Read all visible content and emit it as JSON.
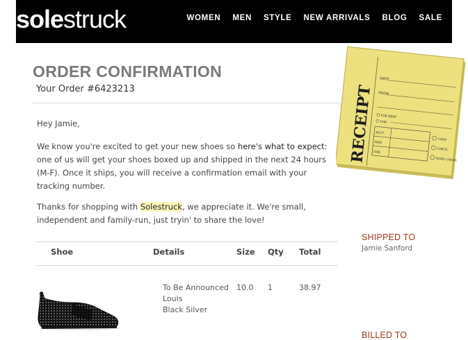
{
  "header": {
    "logo_bold": "sole",
    "logo_light": "struck",
    "nav": [
      "WOMEN",
      "MEN",
      "STYLE",
      "NEW ARRIVALS",
      "BLOG",
      "SALE"
    ]
  },
  "order": {
    "title": "ORDER CONFIRMATION",
    "number_line": "Your Order #6423213"
  },
  "message": {
    "greeting": "Hey Jamie,",
    "p1_before": "We know you're excited to get your new shoes so ",
    "p1_emphasis": "here's what to expect:",
    "p1_after": " one of us will get your shoes boxed up and shipped in the next 24 hours (M-F). Once it ships, you will receive a confirmation email with your tracking number.",
    "p2_before": "Thanks for shopping with ",
    "p2_highlight": "Solestruck",
    "p2_after": ", we appreciate it. We're small, independent and family-run, just tryin' to share the love!"
  },
  "table": {
    "headers": {
      "shoe": "Shoe",
      "details": "Details",
      "size": "Size",
      "qty": "Qty",
      "total": "Total"
    },
    "row": {
      "details": [
        "To Be Announced",
        "Louis",
        "Black Silver"
      ],
      "size": "10.0",
      "qty": "1",
      "total": "38.97"
    }
  },
  "receipt_image": {
    "heading": "RECEIPT",
    "fields": [
      "DATE",
      "FROM",
      "FOR RENT",
      "FOR",
      "ACCT.",
      "PAID",
      "DUE",
      "CASH",
      "CHECK",
      "MONEY ORDER"
    ]
  },
  "sidebar": {
    "shipped_to_label": "SHIPPED TO",
    "shipped_to_name": "Jamie Sanford",
    "billed_to_label": "BILLED TO"
  }
}
